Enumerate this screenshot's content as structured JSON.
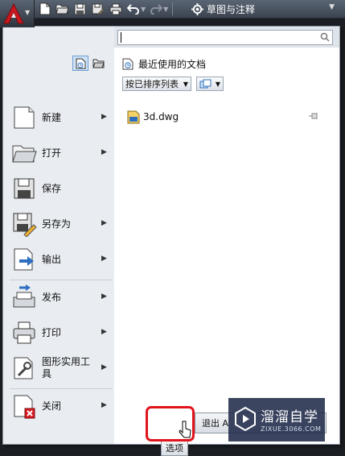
{
  "qat": {
    "workspace_label": "草图与注释",
    "icons": [
      "new-file-icon",
      "open-folder-icon",
      "save-icon",
      "save-as-icon",
      "print-icon",
      "undo-icon",
      "redo-icon"
    ]
  },
  "search": {
    "value": ""
  },
  "left": {
    "items": [
      {
        "label": "新建",
        "icon": "new-icon",
        "has_submenu": true
      },
      {
        "label": "打开",
        "icon": "open-icon",
        "has_submenu": true
      },
      {
        "label": "保存",
        "icon": "save-icon",
        "has_submenu": false
      },
      {
        "label": "另存为",
        "icon": "save-as-icon",
        "has_submenu": true
      },
      {
        "label": "输出",
        "icon": "export-icon",
        "has_submenu": true
      },
      {
        "label": "发布",
        "icon": "publish-icon",
        "has_submenu": true
      },
      {
        "label": "打印",
        "icon": "print-icon",
        "has_submenu": true
      },
      {
        "label": "图形实用工具",
        "icon": "drawing-utilities-icon",
        "has_submenu": true
      },
      {
        "label": "关闭",
        "icon": "close-icon",
        "has_submenu": true
      }
    ]
  },
  "right": {
    "title": "最近使用的文档",
    "sort_label": "按已排序列表",
    "files": [
      {
        "name": "3d.dwg"
      }
    ]
  },
  "buttons": {
    "options": "选项",
    "exit": "退出 A"
  },
  "watermark": {
    "name": "溜溜自学",
    "url": "ZIXUE.3066.COM"
  },
  "colors": {
    "highlight": "#e1141b",
    "menu_bg": "#e9edf2",
    "accent_blue": "#2e6fc0"
  }
}
